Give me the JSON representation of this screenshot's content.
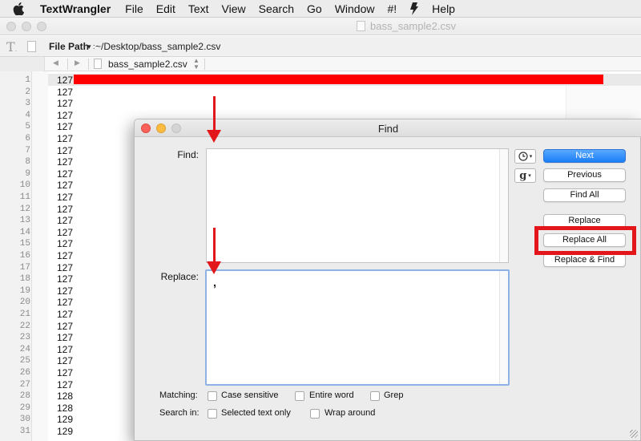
{
  "menubar": {
    "app_name": "TextWrangler",
    "items": [
      "File",
      "Edit",
      "Text",
      "View",
      "Search",
      "Go",
      "Window",
      "#!",
      "Help"
    ]
  },
  "window": {
    "title": "bass_sample2.csv"
  },
  "pathbar": {
    "label": "File Path",
    "caret": "▾ :",
    "value": "~/Desktop/bass_sample2.csv"
  },
  "navbar": {
    "back": "◀",
    "forward": "▶",
    "filename": "bass_sample2.csv"
  },
  "editor": {
    "line_numbers": [
      "1",
      "2",
      "3",
      "4",
      "5",
      "6",
      "7",
      "8",
      "9",
      "10",
      "11",
      "12",
      "13",
      "14",
      "15",
      "16",
      "17",
      "18",
      "19",
      "20",
      "21",
      "22",
      "23",
      "24",
      "25",
      "26",
      "27",
      "28",
      "29",
      "30",
      "31"
    ],
    "lines": [
      "127",
      "127",
      "127",
      "127",
      "127",
      "127",
      "127",
      "127",
      "127",
      "127",
      "127",
      "127",
      "127",
      "127",
      "127",
      "127",
      "127",
      "127",
      "127",
      "127",
      "127",
      "127",
      "127",
      "127",
      "127",
      "127",
      "127",
      "128",
      "128",
      "129",
      "129"
    ]
  },
  "find_dialog": {
    "title": "Find",
    "find_label": "Find:",
    "find_value": "",
    "replace_label": "Replace:",
    "replace_value": ",",
    "buttons": {
      "next": "Next",
      "previous": "Previous",
      "find_all": "Find All",
      "replace": "Replace",
      "replace_all": "Replace All",
      "replace_and_find": "Replace & Find"
    },
    "history_icon": "clock-icon",
    "grep_pattern_icon": "g",
    "matching_label": "Matching:",
    "search_in_label": "Search in:",
    "options": {
      "case_sensitive": {
        "label": "Case sensitive",
        "checked": false
      },
      "entire_word": {
        "label": "Entire word",
        "checked": false
      },
      "grep": {
        "label": "Grep",
        "checked": false
      },
      "selected_text_only": {
        "label": "Selected text only",
        "checked": false
      },
      "wrap_around": {
        "label": "Wrap around",
        "checked": false
      }
    }
  },
  "annotation_colors": {
    "highlight_bar": "#ff0000",
    "arrow": "#e3161c",
    "box": "#e3161c"
  }
}
